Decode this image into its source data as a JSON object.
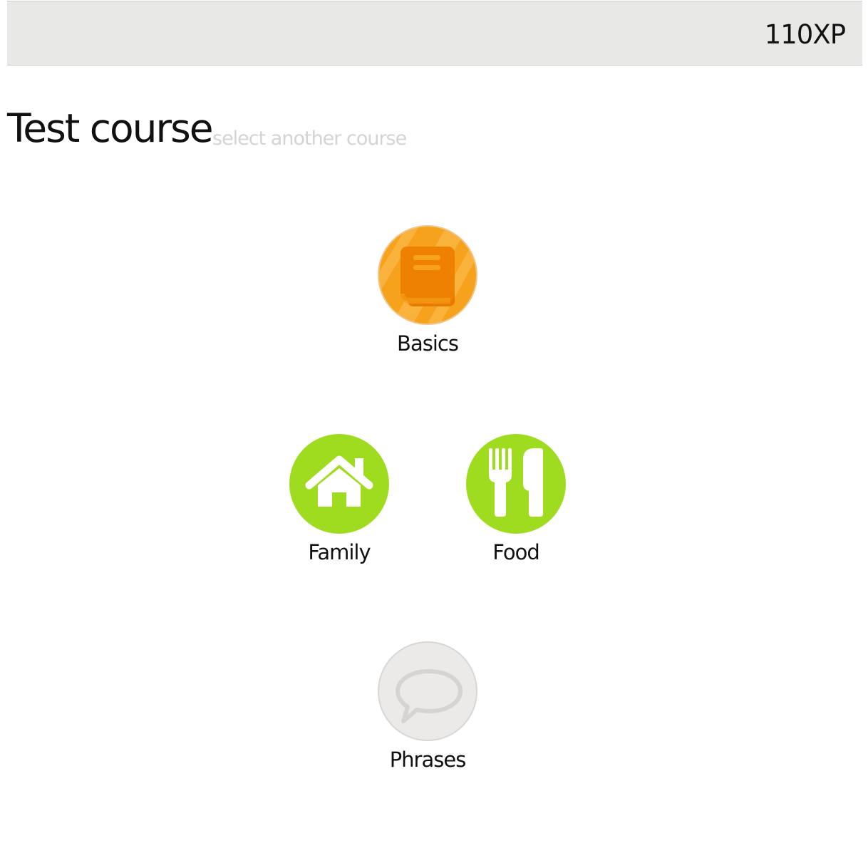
{
  "header": {
    "xp": "110XP"
  },
  "course": {
    "title": "Test course",
    "select_link": "select another course"
  },
  "skills": [
    {
      "label": "Basics",
      "icon": "book-icon",
      "state": "in-progress",
      "color": "#f6a21c"
    },
    {
      "label": "Family",
      "icon": "house-icon",
      "state": "unlocked",
      "color": "#9fdc1f"
    },
    {
      "label": "Food",
      "icon": "fork-knife-icon",
      "state": "unlocked",
      "color": "#9fdc1f"
    },
    {
      "label": "Phrases",
      "icon": "speech-bubble-icon",
      "state": "locked",
      "color": "#eceae8"
    }
  ]
}
